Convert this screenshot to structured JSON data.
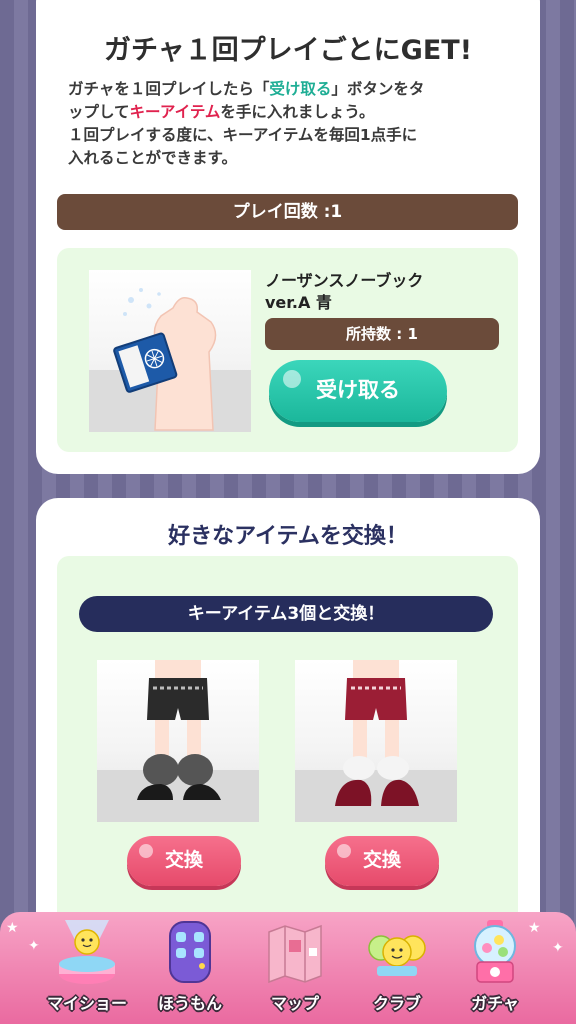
{
  "reward_card": {
    "headline": "ガチャ１回プレイごとにGET!",
    "desc": {
      "l1_a": "ガチャを１回プレイしたら「",
      "l1_b": "受け取る",
      "l1_c": "」ボタンをタ",
      "l2_a": "ップして",
      "l2_b": "キーアイテム",
      "l2_c": "を手に入れましょう。",
      "l3": "１回プレイする度に、キーアイテムを毎回1点手に",
      "l4": "入れることができます。"
    },
    "play_count_label": "プレイ回数 :1",
    "item_name_line1": "ノーザンスノーブック",
    "item_name_line2": "ver.A 青",
    "owned_label": "所持数 : 1",
    "receive_button": "受け取る"
  },
  "exchange_card": {
    "title": "好きなアイテムを交換！",
    "subtitle": "キーアイテム3個と交換！",
    "items": [
      {
        "button": "交換",
        "color": "#2b2b2b"
      },
      {
        "button": "交換",
        "color": "#9b1e35"
      }
    ]
  },
  "bottom_nav": {
    "items": [
      {
        "label": "マイショー",
        "icon": "stage-icon"
      },
      {
        "label": "ほうもん",
        "icon": "door-icon"
      },
      {
        "label": "マップ",
        "icon": "map-icon"
      },
      {
        "label": "クラブ",
        "icon": "club-icon"
      },
      {
        "label": "ガチャ",
        "icon": "gacha-machine-icon"
      }
    ]
  },
  "colors": {
    "accent_teal": "#1fae95",
    "accent_red": "#e0224e",
    "brown_bar": "#6b4b3a",
    "navy_bar": "#262d5c",
    "nav_pink": "#ea6aa0"
  }
}
